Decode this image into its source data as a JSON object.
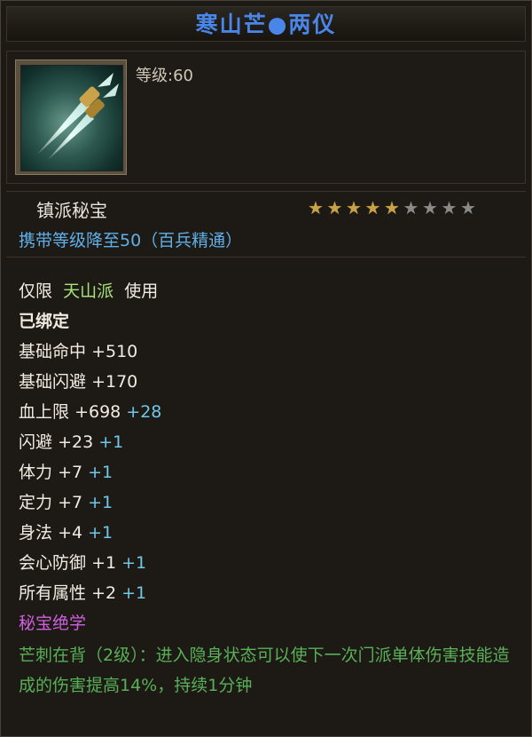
{
  "item": {
    "title": "寒山芒●两仪",
    "level_text": "等级:60",
    "item_type": "镇派秘宝",
    "stars_total": 9,
    "stars_filled": 5,
    "carry_text": "携带等级降至50（百兵精通）",
    "restriction": {
      "prefix": "仅限",
      "school": "天山派",
      "suffix": "使用"
    },
    "bound": "已绑定",
    "stats": [
      {
        "name": "基础命中",
        "base": "+510",
        "bonus": ""
      },
      {
        "name": "基础闪避",
        "base": "+170",
        "bonus": ""
      },
      {
        "name": "血上限",
        "base": "+698",
        "bonus": "+28"
      },
      {
        "name": "闪避",
        "base": "+23",
        "bonus": "+1"
      },
      {
        "name": "体力",
        "base": "+7",
        "bonus": "+1"
      },
      {
        "name": "定力",
        "base": "+7",
        "bonus": "+1"
      },
      {
        "name": "身法",
        "base": "+4",
        "bonus": "+1"
      },
      {
        "name": "会心防御",
        "base": "+1",
        "bonus": "+1"
      },
      {
        "name": "所有属性",
        "base": "+2",
        "bonus": "+1"
      }
    ],
    "skill_header": "秘宝绝学",
    "skill_desc": "芒刺在背（2级）：进入隐身状态可以使下一次门派单体伤害技能造成的伤害提高14%，持续1分钟"
  },
  "colors": {
    "title": "#4a86e8",
    "school": "#a6e37a",
    "bonus": "#71c8e8",
    "skill_header": "#d060e0",
    "skill_desc": "#58b058",
    "carry": "#5fb0e8"
  },
  "icons": {
    "item_icon": "twin-dagger-icon",
    "star": "star-icon"
  }
}
